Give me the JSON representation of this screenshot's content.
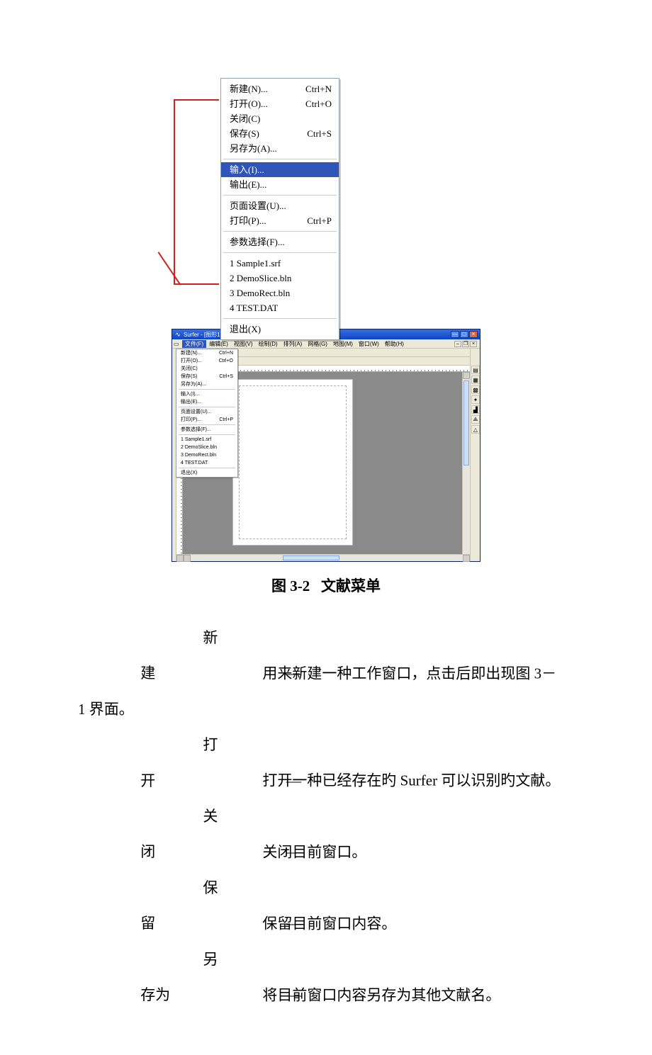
{
  "menu_big": {
    "groups": [
      [
        {
          "label": "新建(N)...",
          "shortcut": "Ctrl+N"
        },
        {
          "label": "打开(O)...",
          "shortcut": "Ctrl+O"
        },
        {
          "label": "关闭(C)",
          "shortcut": ""
        },
        {
          "label": "保存(S)",
          "shortcut": "Ctrl+S"
        },
        {
          "label": "另存为(A)...",
          "shortcut": ""
        }
      ],
      [
        {
          "label": "输入(I)...",
          "shortcut": "",
          "selected": true
        },
        {
          "label": "输出(E)...",
          "shortcut": ""
        }
      ],
      [
        {
          "label": "页面设置(U)...",
          "shortcut": ""
        },
        {
          "label": "打印(P)...",
          "shortcut": "Ctrl+P"
        }
      ],
      [
        {
          "label": "参数选择(F)...",
          "shortcut": ""
        }
      ],
      [
        {
          "label": "1 Sample1.srf",
          "shortcut": ""
        },
        {
          "label": "2 DemoSlice.bln",
          "shortcut": ""
        },
        {
          "label": "3 DemoRect.bln",
          "shortcut": ""
        },
        {
          "label": "4 TEST.DAT",
          "shortcut": ""
        }
      ],
      [
        {
          "label": "退出(X)",
          "shortcut": ""
        }
      ]
    ]
  },
  "surfer": {
    "title": "Surfer - [图形1]",
    "menubar": [
      "文件(F)",
      "编辑(E)",
      "视图(V)",
      "绘制(D)",
      "排列(A)",
      "网格(G)",
      "地图(M)",
      "窗口(W)",
      "帮助(H)"
    ],
    "active_menu_index": 0,
    "file_menu": {
      "groups": [
        [
          {
            "label": "新建(N)...",
            "shortcut": "Ctrl+N"
          },
          {
            "label": "打开(O)...",
            "shortcut": "Ctrl+O"
          },
          {
            "label": "关闭(C)",
            "shortcut": ""
          },
          {
            "label": "保存(S)",
            "shortcut": "Ctrl+S"
          },
          {
            "label": "另存为(A)...",
            "shortcut": ""
          }
        ],
        [
          {
            "label": "输入(I)...",
            "shortcut": ""
          },
          {
            "label": "输出(E)...",
            "shortcut": ""
          }
        ],
        [
          {
            "label": "页面设置(U)...",
            "shortcut": ""
          },
          {
            "label": "打印(P)...",
            "shortcut": "Ctrl+P"
          }
        ],
        [
          {
            "label": "参数选择(F)...",
            "shortcut": ""
          }
        ],
        [
          {
            "label": "1 Sample1.srf",
            "shortcut": ""
          },
          {
            "label": "2 DemoSlice.bln",
            "shortcut": ""
          },
          {
            "label": "3 DemoRect.bln",
            "shortcut": ""
          },
          {
            "label": "4 TEST.DAT",
            "shortcut": ""
          }
        ],
        [
          {
            "label": "退出(X)",
            "shortcut": ""
          }
        ]
      ]
    }
  },
  "caption": {
    "figno": "图 3-2",
    "title": "文献菜单"
  },
  "definitions": [
    {
      "term": "新建",
      "desc": "用来新建一种工作窗口，点击后即出现图 3－1 界面。",
      "wrap": true
    },
    {
      "term": "打开",
      "desc": "打开一种已经存在旳 Surfer 可以识别旳文献。"
    },
    {
      "term": "关闭",
      "desc": "关闭目前窗口。"
    },
    {
      "term": "保留",
      "desc": "保留目前窗口内容。"
    },
    {
      "term": "另存为",
      "desc": "将目前窗口内容另存为其他文献名。"
    }
  ],
  "glyph": {
    "dash": "—",
    "min": "—",
    "max": "□",
    "close": "×",
    "arrow_l": "←",
    "arrow_r": "→",
    "help": "?",
    "doc": "▯",
    "T": "T",
    "pen": "/",
    "N": "N",
    "diamond": "◆"
  }
}
